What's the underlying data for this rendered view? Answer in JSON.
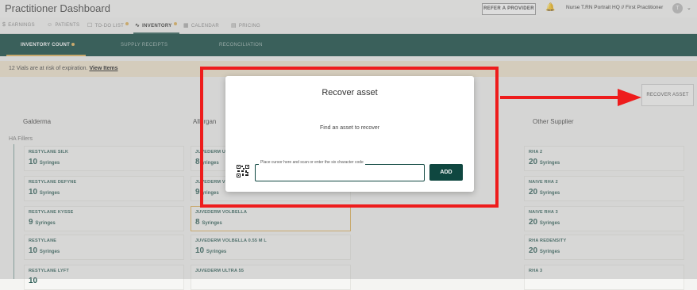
{
  "header": {
    "app_title": "Practitioner Dashboard",
    "refer_label": "REFER A PROVIDER",
    "user_name": "Nurse T.RN Portrait HQ // First Practitioner",
    "avatar_initial": "T"
  },
  "tabs": [
    {
      "label": "EARNINGS",
      "icon": "$"
    },
    {
      "label": "PATIENTS",
      "icon": "☺"
    },
    {
      "label": "TO-DO LIST",
      "icon": "☐"
    },
    {
      "label": "INVENTORY",
      "icon": "∿"
    },
    {
      "label": "CALENDAR",
      "icon": "▦"
    },
    {
      "label": "PRICING",
      "icon": "▤"
    }
  ],
  "subtabs": [
    "INVENTORY COUNT",
    "SUPPLY RECEIPTS",
    "RECONCILIATION"
  ],
  "banner": {
    "text": "12 Vials are at risk of expiration.",
    "link": "View Items"
  },
  "recover_button": "RECOVER ASSET",
  "columns": {
    "col1": "Galderma",
    "col2": "Allergan",
    "col3": "Other Supplier"
  },
  "section_label": "HA Fillers",
  "cards": {
    "galderma": [
      {
        "name": "RESTYLANE SILK",
        "qty": "10",
        "unit": "Syringes"
      },
      {
        "name": "RESTYLANE DEFYNE",
        "qty": "10",
        "unit": "Syringes"
      },
      {
        "name": "RESTYLANE KYSSE",
        "qty": "9",
        "unit": "Syringes"
      },
      {
        "name": "RESTYLANE",
        "qty": "10",
        "unit": "Syringes"
      },
      {
        "name": "RESTYLANE LYFT",
        "qty": "10",
        "unit": ""
      }
    ],
    "allergan": [
      {
        "name": "JUVEDERM U",
        "qty": "8",
        "unit": "yringes"
      },
      {
        "name": "JUVEDERM V",
        "qty": "9",
        "unit": "yringes"
      },
      {
        "name": "JUVEDERM VOLBELLA",
        "qty": "8",
        "unit": "Syringes"
      },
      {
        "name": "JUVEDERM VOLBELLA 0.55 M L",
        "qty": "10",
        "unit": "Syringes"
      },
      {
        "name": "JUVEDERM ULTRA 55",
        "qty": "",
        "unit": ""
      }
    ],
    "other": [
      {
        "name": "RHA 2",
        "qty": "20",
        "unit": "Syringes"
      },
      {
        "name": "NAIVE RHA 2",
        "qty": "20",
        "unit": "Syringes"
      },
      {
        "name": "NAIVE RHA 3",
        "qty": "20",
        "unit": "Syringes"
      },
      {
        "name": "RHA REDENSITY",
        "qty": "20",
        "unit": "Syringes"
      },
      {
        "name": "RHA 3",
        "qty": "",
        "unit": ""
      }
    ]
  },
  "modal": {
    "title": "Recover asset",
    "subtitle": "Find an asset to recover",
    "field_label": "Place cursor here and scan or enter the six character code",
    "field_value": "",
    "add_label": "ADD"
  },
  "annotation_color": "#ee1c1c",
  "brand_color": "#0f4740",
  "accent_color": "#e0b35a"
}
